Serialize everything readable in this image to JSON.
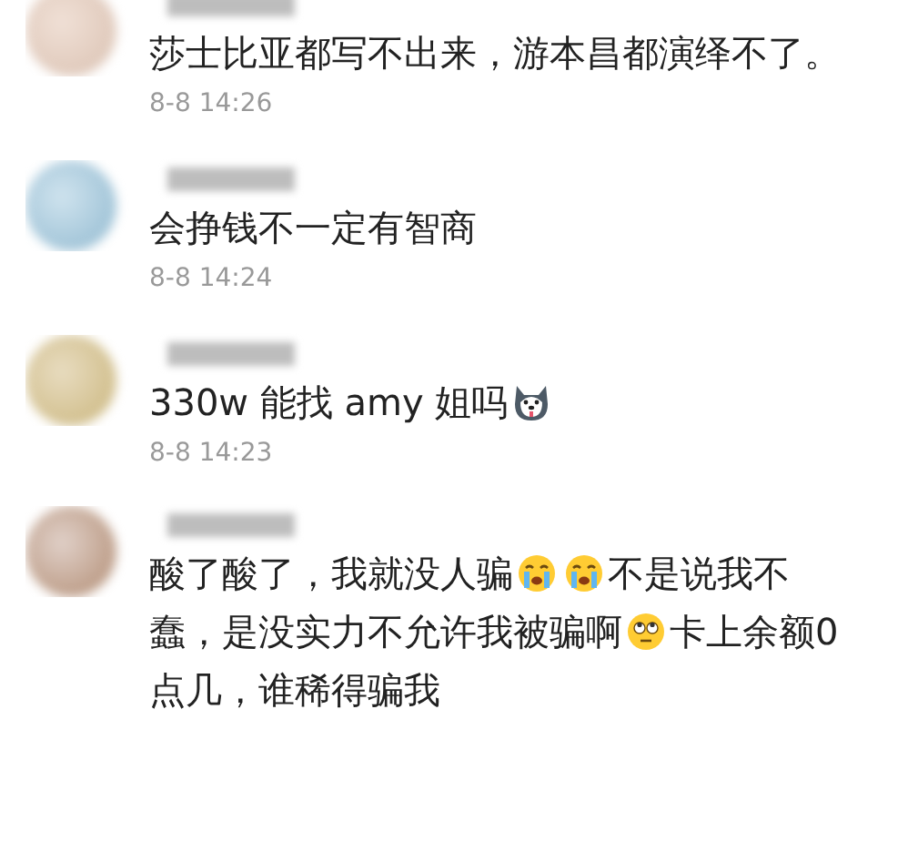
{
  "comments": [
    {
      "lines": [
        [
          {
            "kind": "text",
            "text": "莎士比亚都写不出来，游本昌都演绎不了。"
          }
        ]
      ],
      "time": "8-8 14:26"
    },
    {
      "lines": [
        [
          {
            "kind": "text",
            "text": "会挣钱不一定有智商"
          }
        ]
      ],
      "time": "8-8 14:24"
    },
    {
      "lines": [
        [
          {
            "kind": "text",
            "text": "330w 能找 amy 姐吗"
          },
          {
            "kind": "husky"
          }
        ]
      ],
      "time": "8-8 14:23"
    },
    {
      "lines": [
        [
          {
            "kind": "text",
            "text": "酸了酸了，我就没人骗"
          },
          {
            "kind": "crying"
          },
          {
            "kind": "crying"
          },
          {
            "kind": "text",
            "text": "不是说我不"
          }
        ],
        [
          {
            "kind": "text",
            "text": "蠢，是没实力不允许我被骗啊"
          },
          {
            "kind": "rolling-eyes"
          },
          {
            "kind": "text",
            "text": "卡上余额0"
          }
        ],
        [
          {
            "kind": "text",
            "text": "点几，谁稀得骗我"
          }
        ]
      ]
    }
  ]
}
